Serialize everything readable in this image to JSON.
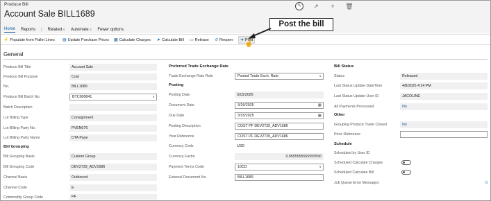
{
  "header": {
    "caption": "Produce Bill",
    "title": "Account Sale BILL1689"
  },
  "tools": [
    "edit-icon",
    "share-icon",
    "add-icon",
    "delete-icon"
  ],
  "actionbar": {
    "home": "Home",
    "reports": "Reports",
    "related": "Related",
    "automate": "Automate",
    "fewer": "Fewer options"
  },
  "commands": {
    "populate": "Populate from Pallet Lines",
    "update_prices": "Update Purchase Prices",
    "calc_charges": "Calculate Charges",
    "calc_bill": "Calculate Bill",
    "release": "Release",
    "reopen": "Reopen",
    "post": "Post"
  },
  "callout": "Post the bill",
  "general": {
    "heading": "General",
    "col1": {
      "title_label": "Produce Bill Title",
      "title_value": "Account Sale",
      "purpose_label": "Produce Bill Purpose",
      "purpose_value": "Cost",
      "no_label": "No.",
      "no_value": "BILL1689",
      "batch_no_label": "Produce Bill Batch No.",
      "batch_no_value": "BTC000841",
      "batch_desc_label": "Batch Description",
      "batch_desc_value": "",
      "lot_type_label": "Lot Billing Type",
      "lot_type_value": "Consignment",
      "lot_party_no_label": "Lot Billing Party No.",
      "lot_party_no_value": "PVEN076",
      "lot_party_name_label": "Lot Billing Party Name",
      "lot_party_name_value": "DTA Pase",
      "bill_grouping_heading": "Bill Grouping",
      "grouping_basis_label": "Bill Grouping Basis",
      "grouping_basis_value": "Custom Group",
      "grouping_code_label": "Bill Grouping Code",
      "grouping_code_value": "DEV2739_ADV1686",
      "channel_basis_label": "Channel Basis",
      "channel_basis_value": "Outbound",
      "channel_code_label": "Channel Code",
      "channel_code_value": "E",
      "commodity_label": "Commodity Group Code",
      "commodity_value": "PF"
    },
    "col2": {
      "fx_heading": "Preferred Trade Exchange Rate",
      "fx_rule_label": "Trade Exchange Rate Rule",
      "fx_rule_value": "Posted Trade Exch. Rate",
      "posting_heading": "Posting",
      "posting_date_label": "Posting Date",
      "posting_date_value": "3/15/2025",
      "document_date_label": "Document Date",
      "document_date_value": "3/15/2025",
      "due_date_label": "Due Date",
      "due_date_value": "3/15/2025",
      "posting_desc_label": "Posting Description",
      "posting_desc_value": "COST PF DEV2739_ADV1686",
      "your_ref_label": "Your Reference",
      "your_ref_value": "COST PF DEV2739_ADV1686",
      "currency_code_label": "Currency Code",
      "currency_code_value": "USD",
      "currency_factor_label": "Currency Factor",
      "currency_factor_value": "0.0555555555555556",
      "payment_terms_label": "Payment Terms Code",
      "payment_terms_value": "10CD",
      "ext_doc_label": "External Document No.",
      "ext_doc_value": "BILL1689"
    },
    "col3": {
      "bill_status_heading": "Bill Status",
      "status_label": "Status",
      "status_value": "Released",
      "last_update_label": "Last Status Update DateTime",
      "last_update_value": "4/8/2025 4:24 PM",
      "last_user_label": "Last Status Update User ID",
      "last_user_value": "JACOLINE",
      "all_paid_label": "All Payments Processed",
      "all_paid_value": "No",
      "other_heading": "Other",
      "grouping_closed_label": "Grouping Produce Trade Closed",
      "grouping_closed_value": "No",
      "price_ref_label": "Price Reference",
      "price_ref_value": "",
      "schedule_heading": "Schedule",
      "sched_user_label": "Scheduled by User ID",
      "sched_user_value": "",
      "sched_charges_label": "Scheduled Calculate Charges",
      "sched_bill_label": "Scheduled Calculate Bill",
      "job_queue_label": "Job Queue Error Messages",
      "job_queue_value": "0"
    }
  }
}
